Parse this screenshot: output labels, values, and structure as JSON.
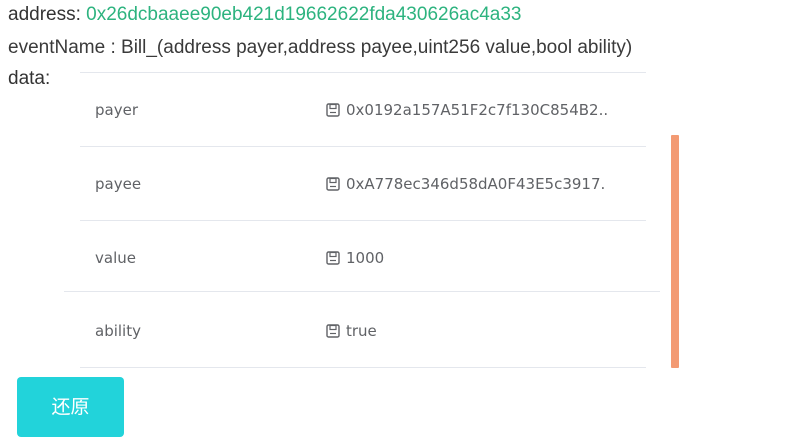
{
  "header": {
    "address_label": "address:",
    "address_value": "0x26dcbaaee90eb421d19662622fda430626ac4a33",
    "event_label": "eventName :",
    "event_value": "Bill_(address payer,address payee,uint256 value,bool ability)",
    "data_label": "data:"
  },
  "data_rows": [
    {
      "key": "payer",
      "icon": "save-icon",
      "value": "0x0192a157A51F2c7f130C854B2.."
    },
    {
      "key": "payee",
      "icon": "save-icon",
      "value": "0xA778ec346d58dA0F43E5c3917."
    },
    {
      "key": "value",
      "icon": "save-icon",
      "value": "1000"
    },
    {
      "key": "ability",
      "icon": "save-icon",
      "value": "true"
    }
  ],
  "actions": {
    "restore_label": "还原"
  },
  "colors": {
    "address": "#2db37f",
    "button": "#22d3da",
    "scrollbar": "#f39a73"
  }
}
